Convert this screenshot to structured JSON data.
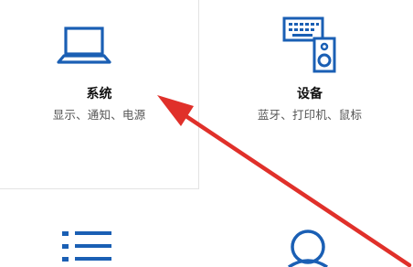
{
  "tiles": {
    "system": {
      "title": "系统",
      "desc": "显示、通知、电源",
      "icon": "laptop-icon"
    },
    "devices": {
      "title": "设备",
      "desc": "蓝牙、打印机、鼠标",
      "icon": "keyboard-speaker-icon"
    },
    "apps": {
      "icon": "list-icon"
    },
    "accounts": {
      "icon": "person-icon"
    }
  },
  "colors": {
    "accent": "#1a5fb4",
    "annotation_arrow": "#e0302a"
  }
}
